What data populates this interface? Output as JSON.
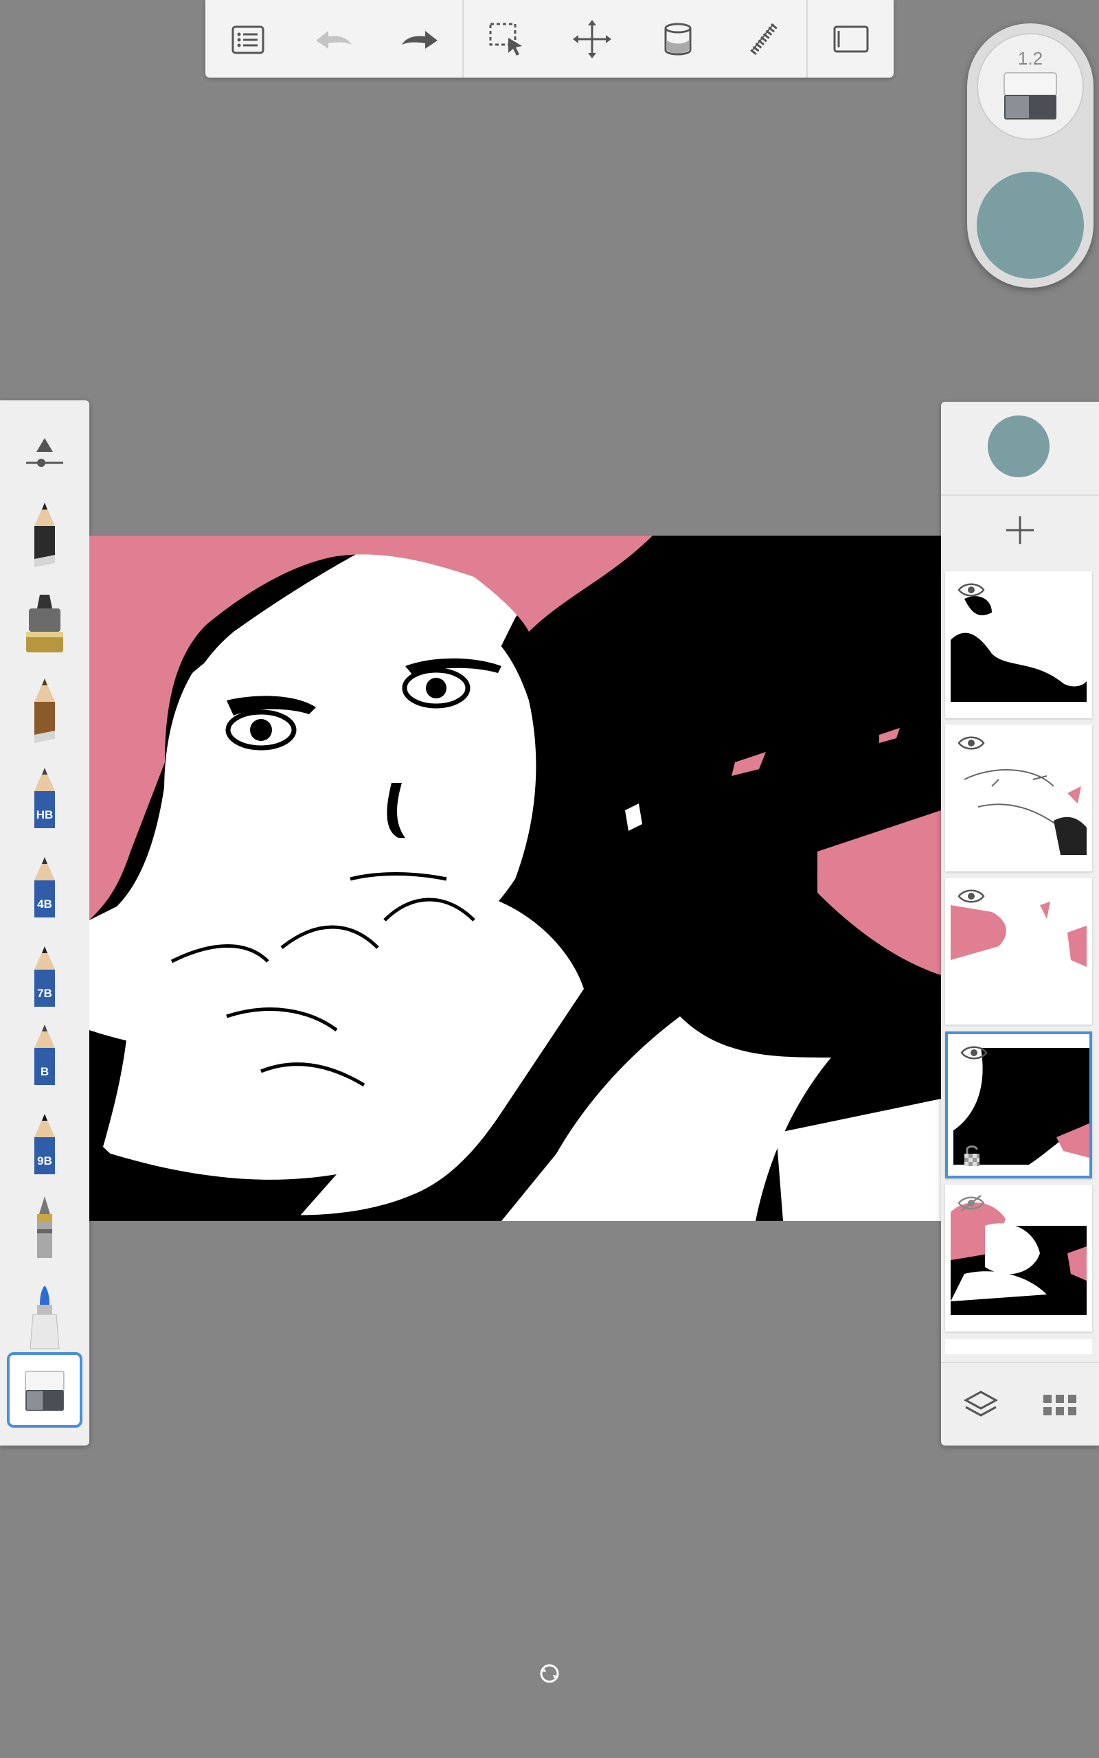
{
  "app": {
    "accent_color": "#4a90d9",
    "background_color": "#858585",
    "current_color": "#7b9ea3"
  },
  "top_toolbar": {
    "buttons": [
      {
        "icon": "list-menu-icon"
      },
      {
        "icon": "undo-icon",
        "disabled": true
      },
      {
        "icon": "redo-icon"
      },
      {
        "icon": "selection-icon"
      },
      {
        "icon": "transform-icon"
      },
      {
        "icon": "fill-bucket-icon"
      },
      {
        "icon": "ruler-icon"
      },
      {
        "icon": "fullscreen-icon"
      }
    ]
  },
  "color_puck": {
    "zoom_label": "1.2",
    "current_tool": "eraser-icon",
    "current_color": "#7b9ea3"
  },
  "brush_toolbar": {
    "brushes": [
      {
        "icon": "brush-settings-icon"
      },
      {
        "icon": "pencil-icon"
      },
      {
        "icon": "marker-icon"
      },
      {
        "icon": "pencil-icon"
      },
      {
        "icon": "pencil-icon",
        "label": "HB"
      },
      {
        "icon": "pencil-icon",
        "label": "4B"
      },
      {
        "icon": "pencil-icon",
        "label": "7B"
      },
      {
        "icon": "pencil-icon",
        "label": "B"
      },
      {
        "icon": "pencil-icon",
        "label": "9B"
      },
      {
        "icon": "ballpoint-pen-icon"
      },
      {
        "icon": "felt-marker-icon"
      },
      {
        "icon": "eraser-icon",
        "selected": true
      }
    ]
  },
  "layers_panel": {
    "layers": [
      {
        "visible": true,
        "selected": false
      },
      {
        "visible": true,
        "selected": false
      },
      {
        "visible": true,
        "selected": false
      },
      {
        "visible": true,
        "selected": true,
        "locked": true
      },
      {
        "visible": false,
        "selected": false
      }
    ]
  }
}
